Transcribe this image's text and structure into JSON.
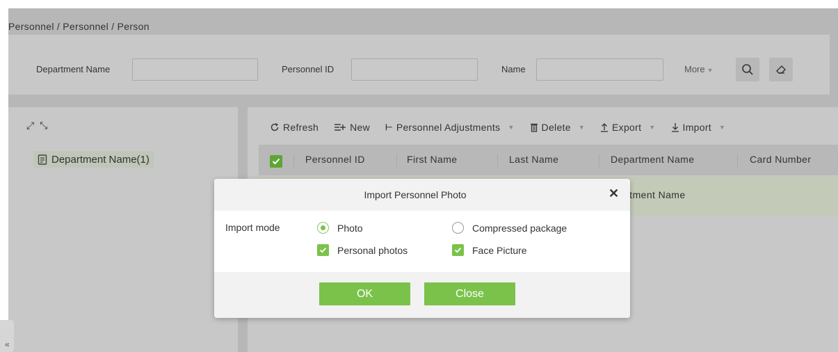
{
  "breadcrumb": "Personnel / Personnel / Person",
  "search": {
    "department_label": "Department Name",
    "department_value": "",
    "personnel_id_label": "Personnel ID",
    "personnel_id_value": "",
    "name_label": "Name",
    "name_value": "",
    "more_label": "More",
    "search_icon": "search-icon",
    "clear_icon": "eraser-icon"
  },
  "tree": {
    "item_label": "Department Name(1)",
    "item_icon": "document-icon",
    "collapse_glyph": "«"
  },
  "toolbar": {
    "refresh": "Refresh",
    "new": "New",
    "adjustments": "Personnel Adjustments",
    "delete": "Delete",
    "export": "Export",
    "import": "Import"
  },
  "table": {
    "columns": [
      "Personnel ID",
      "First Name",
      "Last Name",
      "Department Name",
      "Card Number"
    ],
    "row_partial_text": "›artment Name"
  },
  "modal": {
    "title": "Import Personnel Photo",
    "close_glyph": "✕",
    "import_mode_label": "Import mode",
    "options": {
      "photo": "Photo",
      "compressed": "Compressed package",
      "personal_photos": "Personal photos",
      "face_picture": "Face Picture"
    },
    "selected_mode": "Photo",
    "ok_label": "OK",
    "close_label": "Close"
  },
  "colors": {
    "accent_green": "#7bc24a",
    "overlay_gray": "#b7b7b7"
  }
}
